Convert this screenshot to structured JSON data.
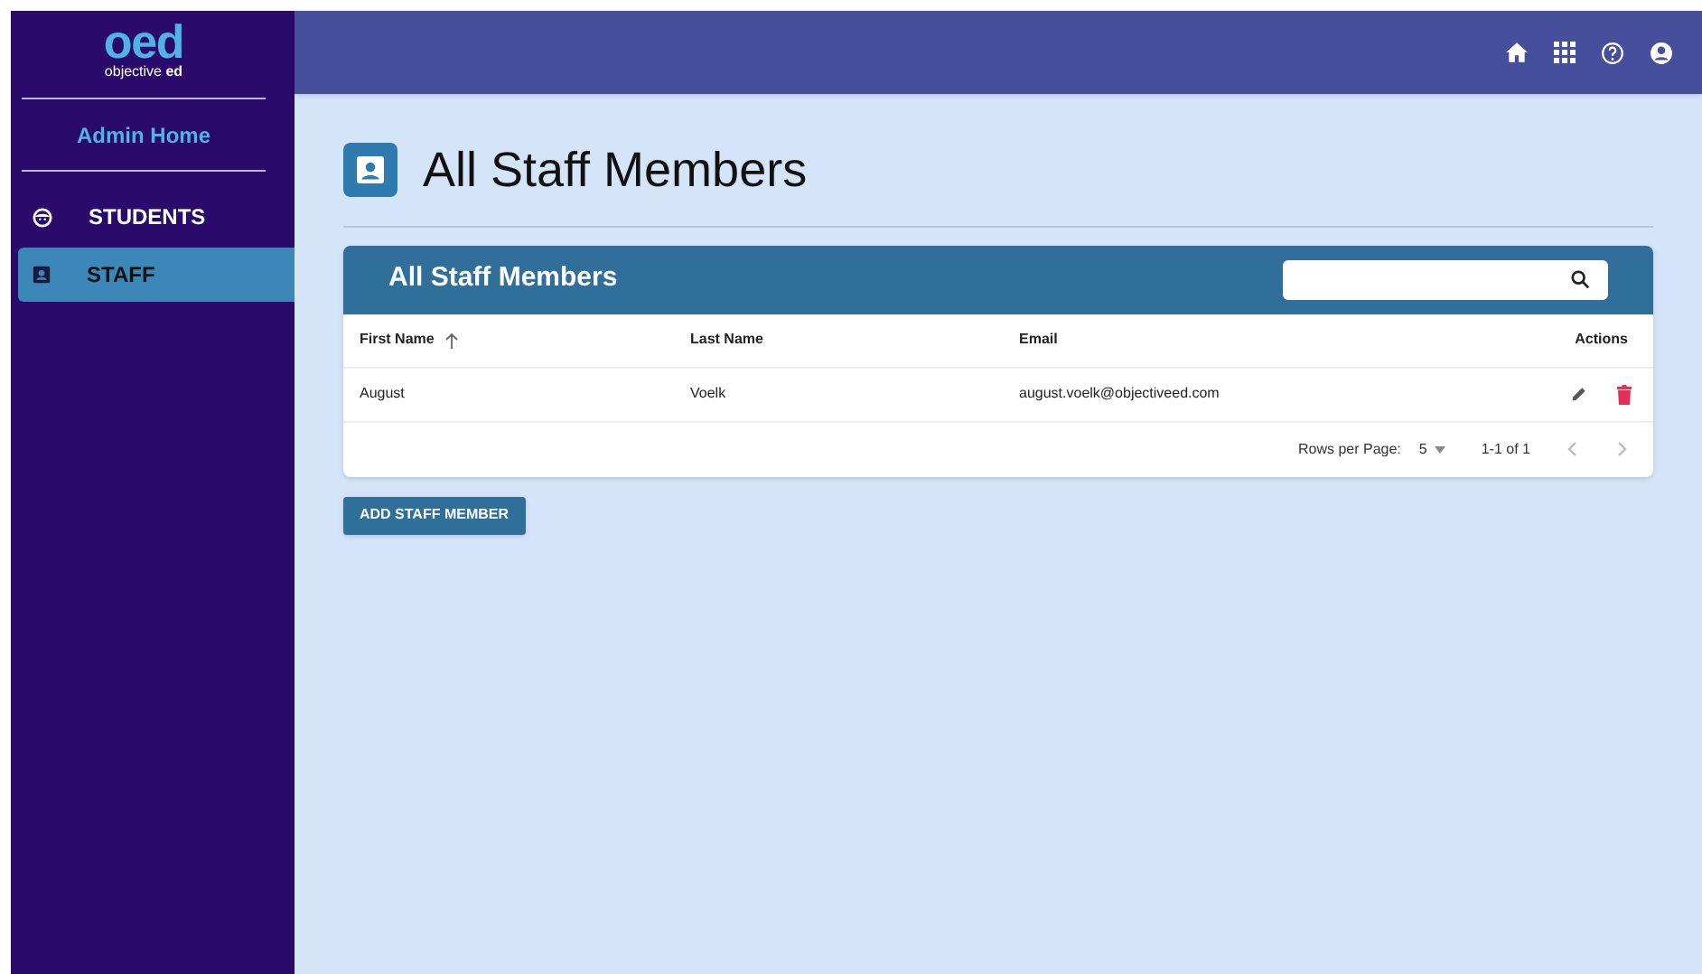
{
  "logo": {
    "mark": "oed",
    "tagline": "objective **ed**"
  },
  "sidebar": {
    "home_link": "Admin Home",
    "items": [
      {
        "label": "STUDENTS",
        "kind": "students",
        "selected": false
      },
      {
        "label": "STAFF",
        "kind": "staff",
        "selected": true
      }
    ]
  },
  "page": {
    "title": "All Staff Members"
  },
  "table": {
    "title": "All Staff Members",
    "columns": [
      {
        "label": "First Name",
        "sorted": true
      },
      {
        "label": "Last Name",
        "sorted": false
      },
      {
        "label": "Email",
        "sorted": false
      },
      {
        "label": "Actions",
        "sorted": false
      }
    ],
    "rows": [
      {
        "first_name": "August",
        "last_name": "Voelk",
        "email": "august.voelk@objectiveed.com"
      }
    ],
    "pagination": {
      "rows_per_page_label": "Rows per Page:",
      "rows_per_page": "5",
      "range": "1-1 of 1"
    }
  },
  "add_button": "ADD STAFF MEMBER"
}
